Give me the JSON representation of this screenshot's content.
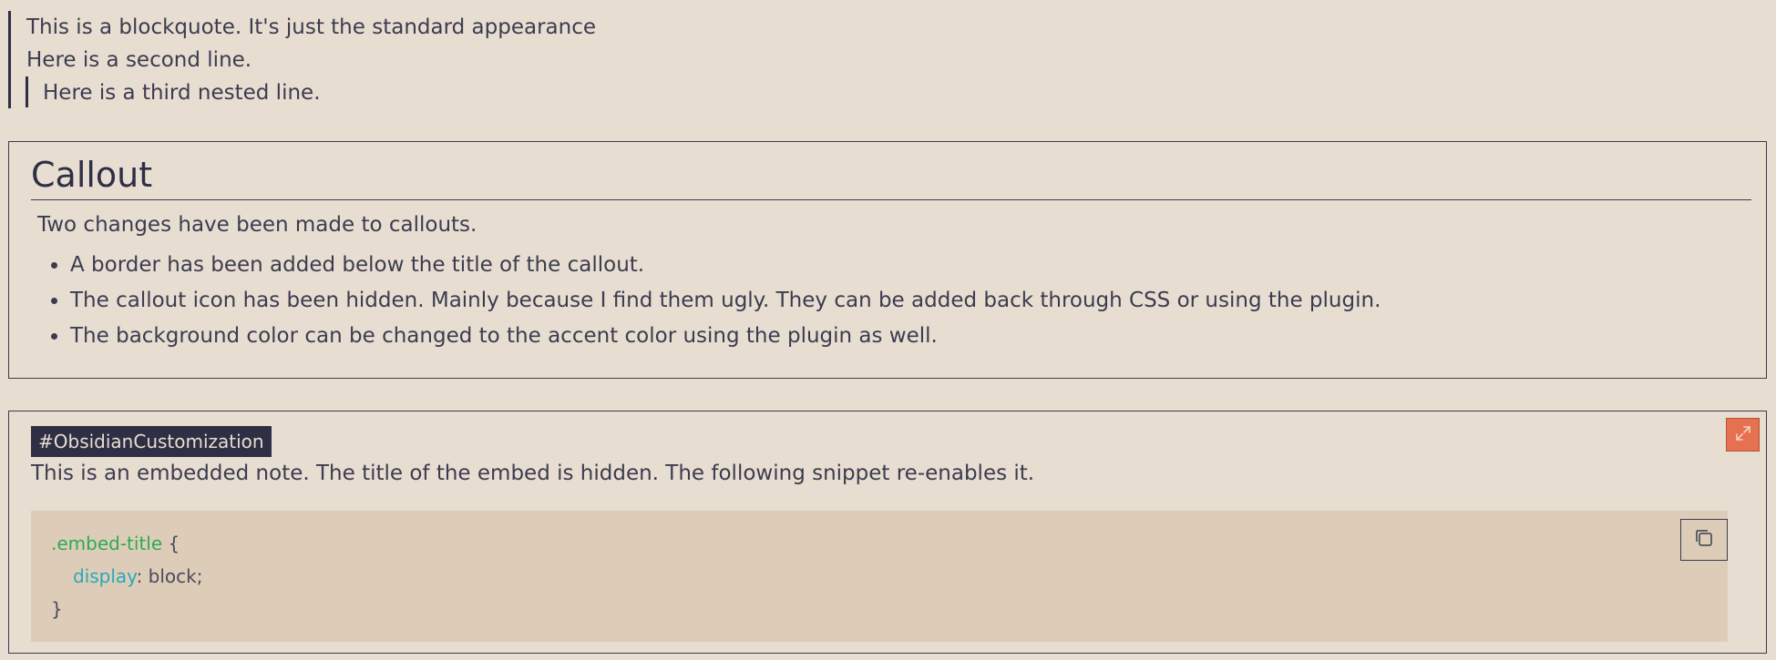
{
  "blockquote": {
    "line1": "This is a blockquote. It's just the standard appearance",
    "line2": "Here is a second line.",
    "nested_line": "Here is a third nested line."
  },
  "callout": {
    "title": "Callout",
    "intro": "Two changes have been made to callouts.",
    "items": [
      "A border has been added below the title of the callout.",
      "The callout icon has been hidden. Mainly because I find them ugly. They can be added back through CSS or using the plugin.",
      "The background color can be changed to the accent color using the plugin as well."
    ]
  },
  "embed": {
    "tag": "#ObsidianCustomization",
    "text": "This is an embedded note. The title of the embed is hidden. The following snippet re-enables it.",
    "expand_icon": "expand-icon",
    "code": {
      "selector": ".embed-title",
      "open_brace": " {",
      "property": "display",
      "value": ": block;",
      "close_brace": "}"
    },
    "copy_icon": "copy-icon"
  },
  "colors": {
    "background": "#e8ddd1",
    "text": "#3b3c4f",
    "accent": "#e57150",
    "code_background": "#ddcdb8",
    "tag_background": "#2e2f45",
    "code_selector": "#2eaa56",
    "code_property": "#2aa8b8"
  }
}
